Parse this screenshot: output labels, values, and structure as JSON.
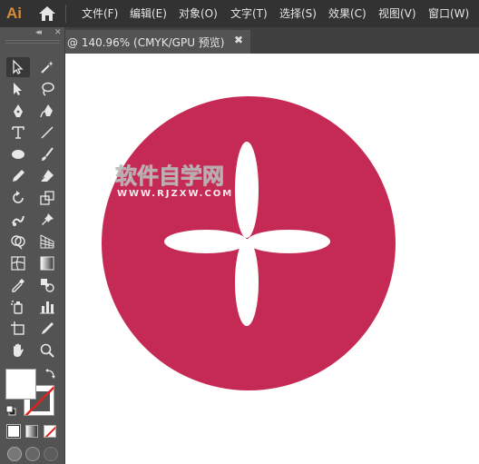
{
  "app": {
    "logo": "Ai"
  },
  "menu": [
    {
      "label": "文件(F)"
    },
    {
      "label": "编辑(E)"
    },
    {
      "label": "对象(O)"
    },
    {
      "label": "文字(T)"
    },
    {
      "label": "选择(S)"
    },
    {
      "label": "效果(C)"
    },
    {
      "label": "视图(V)"
    },
    {
      "label": "窗口(W)"
    }
  ],
  "document_tab": {
    "title": "@ 140.96% (CMYK/GPU 预览)",
    "close": "✖"
  },
  "tools_panel": {
    "collapse": "◂◂",
    "close": "✕"
  },
  "artwork": {
    "circle_color": "#c52a55",
    "petal_color": "#ffffff",
    "watermark_title": "软件自学网",
    "watermark_url": "WWW.RJZXW.COM"
  },
  "swatches": {
    "fill": "#ffffff",
    "stroke": "none"
  },
  "colors": {
    "menubar": "#323232",
    "panel": "#535353",
    "tabbar": "#404040",
    "accent_stroke_none": "#e02020"
  }
}
